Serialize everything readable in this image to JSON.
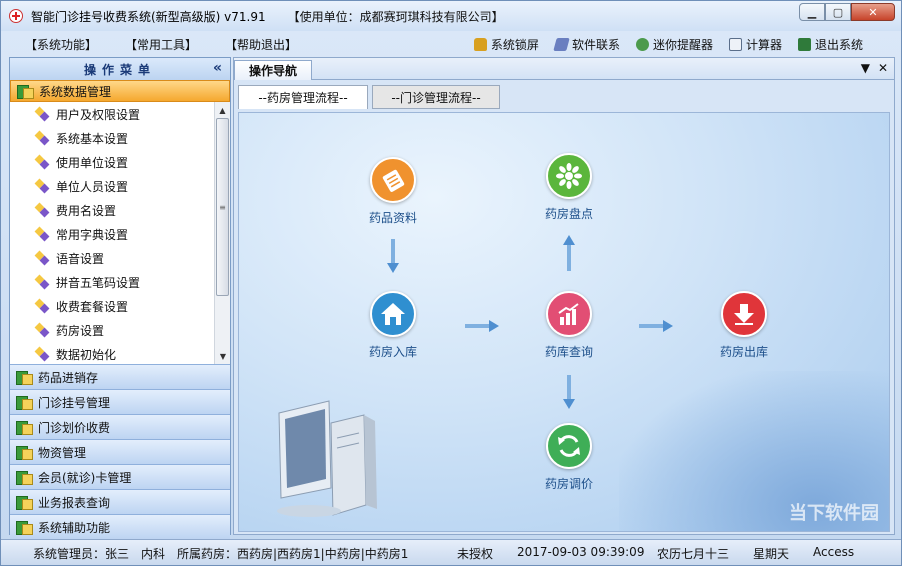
{
  "window": {
    "title": "智能门诊挂号收费系统(新型高级版) v71.91",
    "unit": "【使用单位：成都赛珂琪科技有限公司】"
  },
  "menus": [
    "【系统功能】",
    "【常用工具】",
    "【帮助退出】"
  ],
  "toolbar": {
    "lock": "系统锁屏",
    "contact": "软件联系",
    "reminder": "迷你提醒器",
    "calculator": "计算器",
    "exit": "退出系统"
  },
  "sidebar": {
    "header": "操作菜单",
    "collapse": "«",
    "active_group": "系统数据管理",
    "subitems": [
      "用户及权限设置",
      "系统基本设置",
      "使用单位设置",
      "单位人员设置",
      "费用名设置",
      "常用字典设置",
      "语音设置",
      "拼音五笔码设置",
      "收费套餐设置",
      "药房设置",
      "数据初始化"
    ],
    "groups": [
      "药品进销存",
      "门诊挂号管理",
      "门诊划价收费",
      "物资管理",
      "会员(就诊)卡管理",
      "业务报表查询",
      "系统辅助功能"
    ]
  },
  "main": {
    "tab": "操作导航",
    "subtabs": [
      "--药房管理流程--",
      "--门诊管理流程--"
    ],
    "nodes": {
      "drug_info": "药品资料",
      "pharmacy_check": "药房盘点",
      "pharmacy_in": "药房入库",
      "stock_query": "药库查询",
      "pharmacy_out": "药房出库",
      "pharmacy_transfer": "药房调价"
    },
    "colors": {
      "drug_info": "#f0922e",
      "pharmacy_check": "#5bb63c",
      "pharmacy_in": "#2f8fd0",
      "stock_query": "#e24e74",
      "pharmacy_out": "#e0353a",
      "pharmacy_transfer": "#3fae57"
    }
  },
  "status": {
    "user": "系统管理员：张三",
    "dept": "内科",
    "pharmacy": "所属药房：西药房|西药房1|中药房|中药房1",
    "license": "未授权",
    "datetime": "2017-09-03 09:39:09",
    "lunar": "农历七月十三",
    "weekday": "星期天",
    "db": "Access"
  },
  "watermark": "当下软件园"
}
